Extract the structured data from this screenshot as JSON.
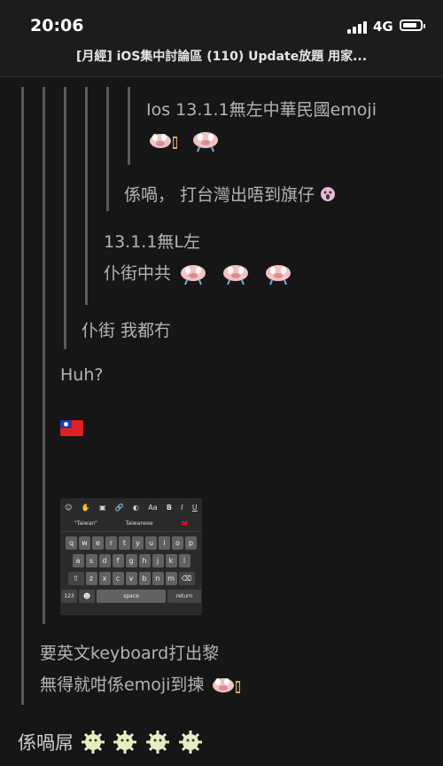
{
  "status": {
    "time": "20:06",
    "network": "4G"
  },
  "thread": {
    "title": "[月經] iOS集中討論區 (110) Update放題 用家..."
  },
  "posts": {
    "p1_line1": "Ios 13.1.1無左中華民國emoji",
    "p2": "係喎， 打台灣出唔到旗仔",
    "p3_line1": "13.1.1無L左",
    "p3_line2": "仆街中共",
    "p4": "仆街 我都冇",
    "p5": "Huh?",
    "p6_line1": "要英文keyboard打出黎",
    "p6_line2": "無得就咁係emoji到揀",
    "p7": "係喎屌"
  },
  "keyboard": {
    "toolbar": [
      "☺",
      "✋",
      "▣",
      "🔗",
      "◐",
      "Aa",
      "B",
      "I",
      "U"
    ],
    "suggestions": [
      "\"Taiwan\"",
      "Taiwanese",
      "🇹🇼"
    ],
    "row1": [
      "q",
      "w",
      "e",
      "r",
      "t",
      "y",
      "u",
      "i",
      "o",
      "p"
    ],
    "row2": [
      "a",
      "s",
      "d",
      "f",
      "g",
      "h",
      "j",
      "k",
      "l"
    ],
    "row3": [
      "z",
      "x",
      "c",
      "v",
      "b",
      "n",
      "m"
    ],
    "shift": "⇧",
    "backspace": "⌫",
    "numbers": "123",
    "emoji": "☻",
    "space": "space",
    "return": "return"
  }
}
